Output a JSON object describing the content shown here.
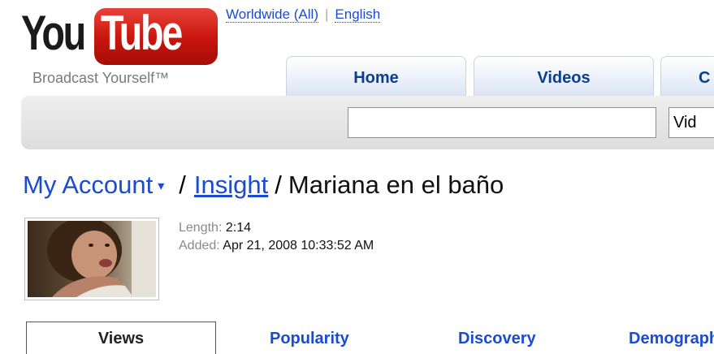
{
  "logo": {
    "you": "You",
    "tube": "Tube",
    "tagline": "Broadcast Yourself™"
  },
  "region": {
    "worldwide": "Worldwide (All)",
    "language": "English"
  },
  "tabs": {
    "home": "Home",
    "videos": "Videos",
    "more": "C"
  },
  "search": {
    "query": "",
    "scope": "Vid"
  },
  "breadcrumb": {
    "account": "My Account",
    "caret": "▾",
    "sep": "/",
    "insight": "Insight",
    "title": "Mariana en el baño"
  },
  "video": {
    "length_label": "Length:",
    "length_value": "2:14",
    "added_label": "Added:",
    "added_value": "Apr 21, 2008 10:33:52 AM"
  },
  "stats_tabs": {
    "views": "Views",
    "popularity": "Popularity",
    "discovery": "Discovery",
    "demographics": "Demographics"
  },
  "colors": {
    "link": "#1a4bd1",
    "tab_text": "#0b3d91",
    "logo_red": "#c7140c"
  }
}
